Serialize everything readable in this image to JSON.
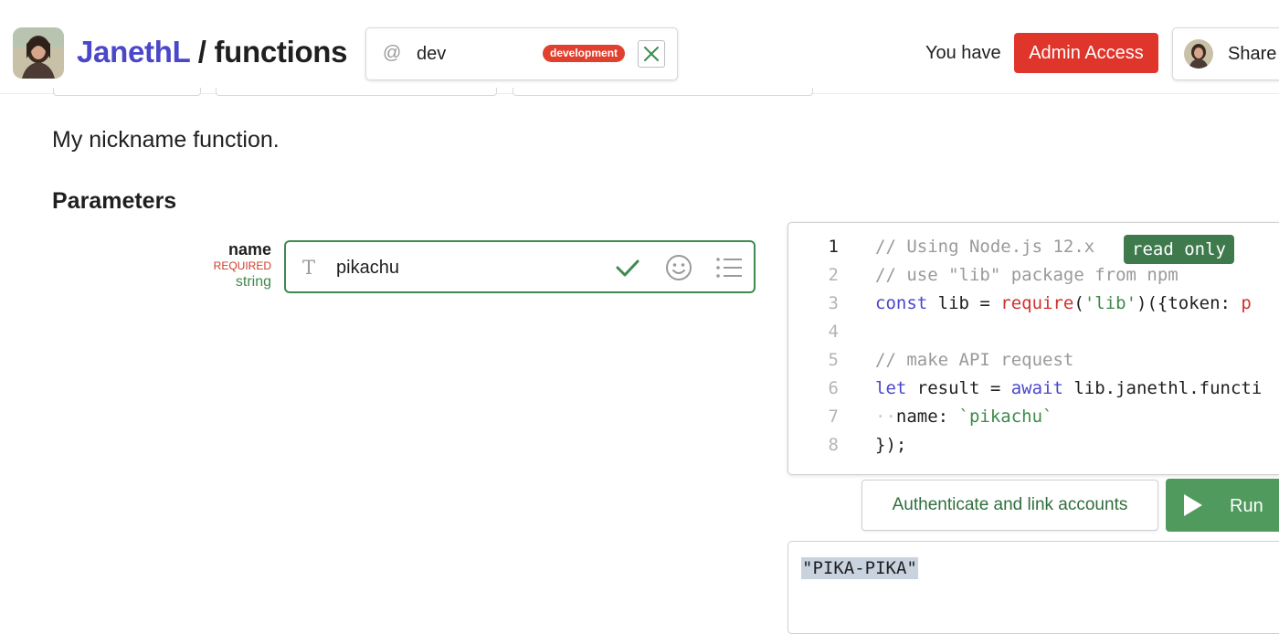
{
  "header": {
    "owner": "JanethL",
    "separator": " / ",
    "repo": "functions",
    "environment": {
      "at_symbol": "@",
      "name": "dev",
      "badge": "development"
    },
    "access_prefix": "You have",
    "access_badge": "Admin Access",
    "share_label": "Share"
  },
  "function": {
    "description": "My nickname function.",
    "parameters_heading": "Parameters",
    "parameters": [
      {
        "name": "name",
        "required_label": "REQUIRED",
        "type": "string",
        "type_glyph": "T",
        "value": "pikachu"
      }
    ]
  },
  "code": {
    "read_only_badge": "read only",
    "lines": [
      {
        "num": "1",
        "tokens": [
          {
            "cls": "c-cmt",
            "text": "// Using Node.js 12.x"
          }
        ]
      },
      {
        "num": "2",
        "tokens": [
          {
            "cls": "c-cmt",
            "text": "// use \"lib\" package from npm"
          }
        ]
      },
      {
        "num": "3",
        "tokens": [
          {
            "cls": "c-kw",
            "text": "const"
          },
          {
            "cls": "c-txt",
            "text": " lib = "
          },
          {
            "cls": "c-fn",
            "text": "require"
          },
          {
            "cls": "c-txt",
            "text": "("
          },
          {
            "cls": "c-str",
            "text": "'lib'"
          },
          {
            "cls": "c-txt",
            "text": ")({token: "
          },
          {
            "cls": "c-fn",
            "text": "p"
          }
        ]
      },
      {
        "num": "4",
        "tokens": []
      },
      {
        "num": "5",
        "tokens": [
          {
            "cls": "c-cmt",
            "text": "// make API request"
          }
        ]
      },
      {
        "num": "6",
        "tokens": [
          {
            "cls": "c-kw",
            "text": "let"
          },
          {
            "cls": "c-txt",
            "text": " result = "
          },
          {
            "cls": "c-kw",
            "text": "await"
          },
          {
            "cls": "c-txt",
            "text": " lib.janethl.functi"
          }
        ]
      },
      {
        "num": "7",
        "tokens": [
          {
            "cls": "c-dot",
            "text": "··"
          },
          {
            "cls": "c-txt",
            "text": "name: "
          },
          {
            "cls": "c-str",
            "text": "`pikachu`"
          }
        ]
      },
      {
        "num": "8",
        "tokens": [
          {
            "cls": "c-txt",
            "text": "});"
          }
        ]
      }
    ]
  },
  "actions": {
    "auth_label": "Authenticate and link accounts",
    "run_label": "Run"
  },
  "result": {
    "value": "\"PIKA-PIKA\""
  },
  "colors": {
    "owner": "#4a47c9",
    "admin_badge": "#e0352b",
    "env_badge": "#e0412f",
    "valid_green": "#3f8a4f",
    "run_button": "#4f9a5c",
    "read_only_badge": "#3f7a4d"
  },
  "icons": {
    "env_clear": "close-icon",
    "param_valid": "check-icon",
    "param_emoji": "emoji-icon",
    "param_list": "list-icon",
    "run": "play-icon"
  }
}
